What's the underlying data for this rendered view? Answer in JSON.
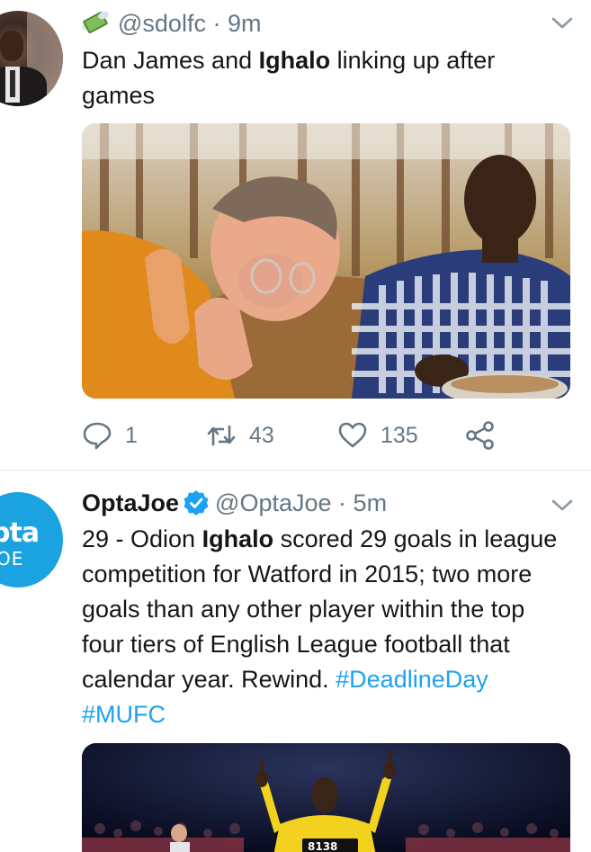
{
  "tweets": [
    {
      "display_name": "",
      "handle": "@sdolfc",
      "separator": "·",
      "time": "9m",
      "text_pre": "Dan James and ",
      "text_bold": "Ighalo",
      "text_post": " linking up after games",
      "stats": {
        "replies": "1",
        "retweets": "43",
        "likes": "135"
      }
    },
    {
      "display_name": "OptaJoe",
      "handle": "@OptaJoe",
      "separator": "·",
      "time": "5m",
      "avatar_text_1": "pta",
      "avatar_text_2": "OE",
      "text_pre": "29 - Odion ",
      "text_bold": "Ighalo",
      "text_post": " scored 29 goals in league competition for Watford in 2015; two more goals than any other player within the top four tiers of English League football that calendar year. Rewind. ",
      "hashtag_1": "#DeadlineDay",
      "hashtag_2": "#MUFC",
      "shirt_number": "8138"
    }
  ],
  "colors": {
    "link": "#1da1f2",
    "secondary_text": "#657786",
    "verified": "#1da1f2",
    "divider": "#e1e8ed"
  },
  "icons": {
    "emoji": "money-with-wings-icon",
    "reply": "reply-icon",
    "retweet": "retweet-icon",
    "like": "heart-icon",
    "share": "share-icon",
    "menu": "chevron-down-icon",
    "verified": "verified-badge-icon"
  }
}
